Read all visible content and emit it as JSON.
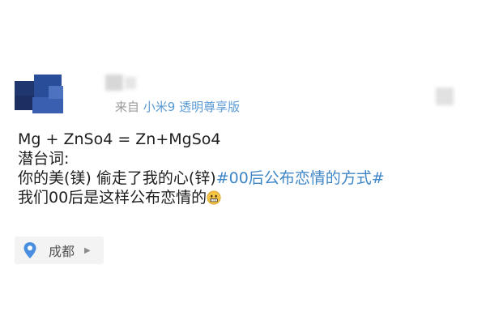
{
  "post": {
    "source_prefix": "来自",
    "source_device": "小米9 透明尊享版",
    "lines": [
      "Mg + ZnSo4 = Zn+MgSo4",
      "潜台词:",
      "你的美(镁) 偷走了我的心(锌)",
      "我们00后是这样公布恋情的"
    ],
    "topic_tag": "#00后公布恋情的方式#",
    "emoji_icon": "grimacing-face-icon"
  },
  "location": {
    "label": "成都",
    "pin_color": "#4a8ee0"
  },
  "colors": {
    "link": "#3f86c7",
    "meta": "#9a9a9a",
    "device": "#5b9bd5"
  }
}
